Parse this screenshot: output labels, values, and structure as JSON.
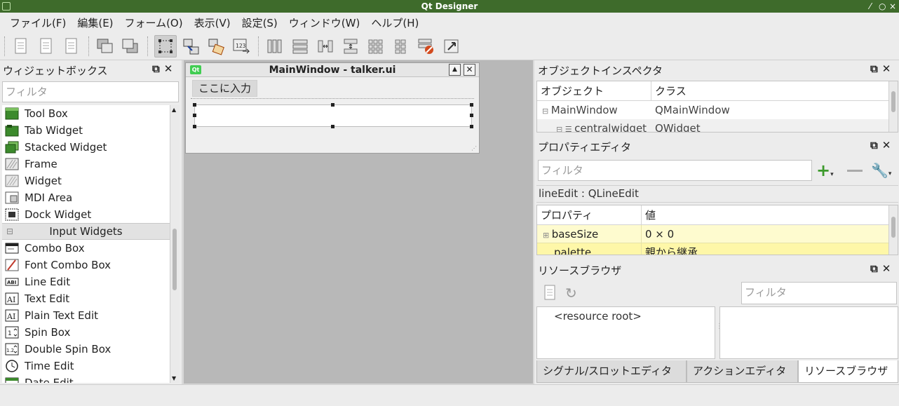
{
  "window": {
    "title": "Qt Designer",
    "controls": [
      "⁄",
      "○",
      "×"
    ]
  },
  "menubar": [
    "ファイル(F)",
    "編集(E)",
    "フォーム(O)",
    "表示(V)",
    "設定(S)",
    "ウィンドウ(W)",
    "ヘルプ(H)"
  ],
  "widgetbox": {
    "title": "ウィジェットボックス",
    "filter_placeholder": "フィルタ",
    "containers": [
      {
        "label": "Tool Box",
        "icon": "toolbox-icon"
      },
      {
        "label": "Tab Widget",
        "icon": "tab-widget-icon"
      },
      {
        "label": "Stacked Widget",
        "icon": "stacked-widget-icon"
      },
      {
        "label": "Frame",
        "icon": "frame-icon"
      },
      {
        "label": "Widget",
        "icon": "widget-icon"
      },
      {
        "label": "MDI Area",
        "icon": "mdi-area-icon"
      },
      {
        "label": "Dock Widget",
        "icon": "dock-widget-icon"
      }
    ],
    "category": "Input Widgets",
    "inputs": [
      {
        "label": "Combo Box",
        "icon": "combo-box-icon"
      },
      {
        "label": "Font Combo Box",
        "icon": "font-combo-box-icon"
      },
      {
        "label": "Line Edit",
        "icon": "line-edit-icon",
        "glyph": "ABI"
      },
      {
        "label": "Text Edit",
        "icon": "text-edit-icon",
        "glyph": "AI"
      },
      {
        "label": "Plain Text Edit",
        "icon": "plain-text-edit-icon",
        "glyph": "AI"
      },
      {
        "label": "Spin Box",
        "icon": "spin-box-icon",
        "glyph": "1"
      },
      {
        "label": "Double Spin Box",
        "icon": "double-spin-box-icon",
        "glyph": "1.2"
      },
      {
        "label": "Time Edit",
        "icon": "time-edit-icon"
      },
      {
        "label": "Date Edit",
        "icon": "date-edit-icon"
      }
    ]
  },
  "form": {
    "title": "MainWindow - talker.ui",
    "menu_placeholder": "ここに入力"
  },
  "inspector": {
    "title": "オブジェクトインスペクタ",
    "col_object": "オブジェクト",
    "col_class": "クラス",
    "rows": [
      {
        "object": "MainWindow",
        "class": "QMainWindow"
      },
      {
        "object": "centralwidget",
        "class": "QWidget"
      }
    ]
  },
  "property_editor": {
    "title": "プロパティエディタ",
    "filter_placeholder": "フィルタ",
    "selected": "lineEdit : QLineEdit",
    "col_property": "プロパティ",
    "col_value": "値",
    "rows": [
      {
        "name": "baseSize",
        "value": "0 × 0"
      },
      {
        "name": "palette",
        "value": "親から継承"
      }
    ]
  },
  "resource_browser": {
    "title": "リソースブラウザ",
    "filter_placeholder": "フィルタ",
    "root": "<resource root>"
  },
  "tabs": [
    "シグナル/スロットエディタ",
    "アクションエディタ",
    "リソースブラウザ"
  ]
}
